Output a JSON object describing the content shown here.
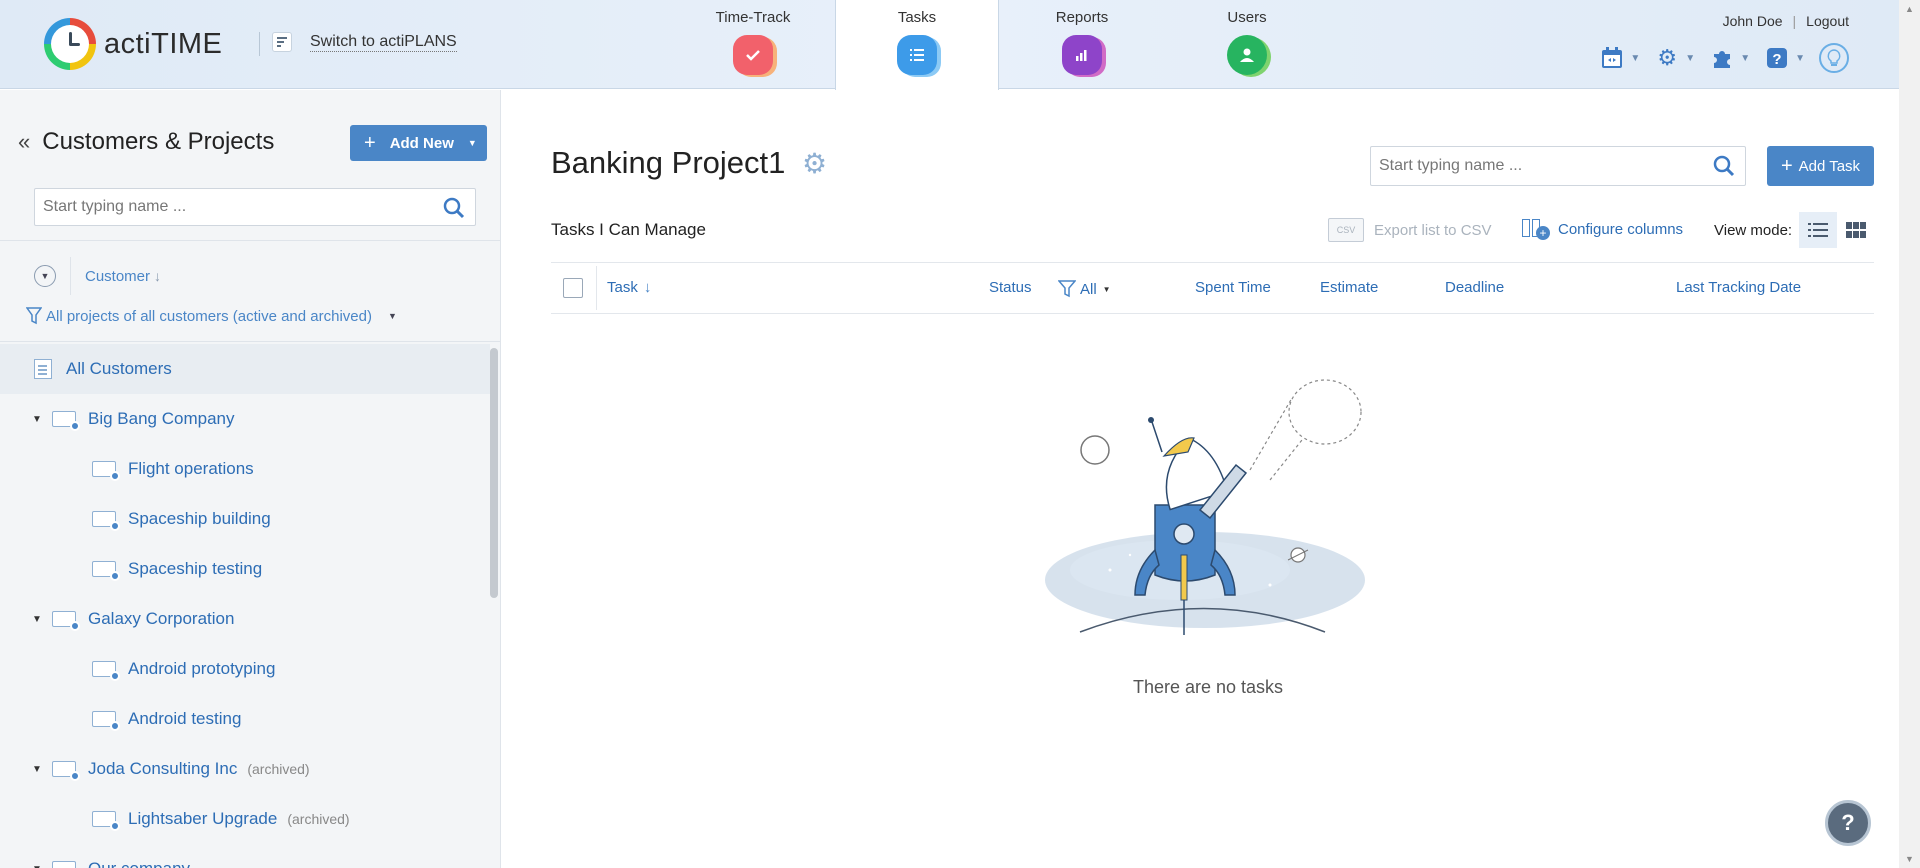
{
  "header": {
    "logo_text": "actiTIME",
    "switch_label": "Switch to actiPLANS",
    "user_name": "John Doe",
    "logout_label": "Logout",
    "nav": [
      {
        "label": "Time-Track",
        "icon": "check-icon",
        "color": "#f2616b"
      },
      {
        "label": "Tasks",
        "icon": "list-icon",
        "color": "#3d9be9",
        "active": true
      },
      {
        "label": "Reports",
        "icon": "chart-icon",
        "color": "#8e44c9"
      },
      {
        "label": "Users",
        "icon": "user-icon",
        "color": "#27b460"
      }
    ]
  },
  "left_panel": {
    "title": "Customers & Projects",
    "add_new_label": "Add New",
    "search_placeholder": "Start typing name ...",
    "sort_label": "Customer",
    "filter_label": "All projects of all customers (active and archived)",
    "all_customers_label": "All Customers",
    "tree": [
      {
        "type": "customer",
        "label": "Big Bang Company",
        "archived": ""
      },
      {
        "type": "project",
        "label": "Flight operations",
        "archived": ""
      },
      {
        "type": "project",
        "label": "Spaceship building",
        "archived": ""
      },
      {
        "type": "project",
        "label": "Spaceship testing",
        "archived": ""
      },
      {
        "type": "customer",
        "label": "Galaxy Corporation",
        "archived": ""
      },
      {
        "type": "project",
        "label": "Android prototyping",
        "archived": ""
      },
      {
        "type": "project",
        "label": "Android testing",
        "archived": ""
      },
      {
        "type": "customer",
        "label": "Joda Consulting Inc",
        "archived": "(archived)"
      },
      {
        "type": "project",
        "label": "Lightsaber Upgrade",
        "archived": "(archived)"
      },
      {
        "type": "customer",
        "label": "Our company",
        "archived": ""
      }
    ]
  },
  "main": {
    "project_title": "Banking Project1",
    "search_placeholder": "Start typing name ...",
    "add_task_label": "Add Task",
    "section_title": "Tasks I Can Manage",
    "export_label": "Export list to CSV",
    "csv_badge": "CSV",
    "configure_label": "Configure columns",
    "view_mode_label": "View mode:",
    "columns": {
      "task": "Task",
      "status": "Status",
      "status_filter": "All",
      "spent_time": "Spent Time",
      "estimate": "Estimate",
      "deadline": "Deadline",
      "last_tracking": "Last Tracking Date"
    },
    "empty_message": "There are no tasks"
  },
  "help_label": "?",
  "colors": {
    "accent": "#4a86c7",
    "link": "#2d6db5",
    "header_bg": "#dfeaf6"
  }
}
